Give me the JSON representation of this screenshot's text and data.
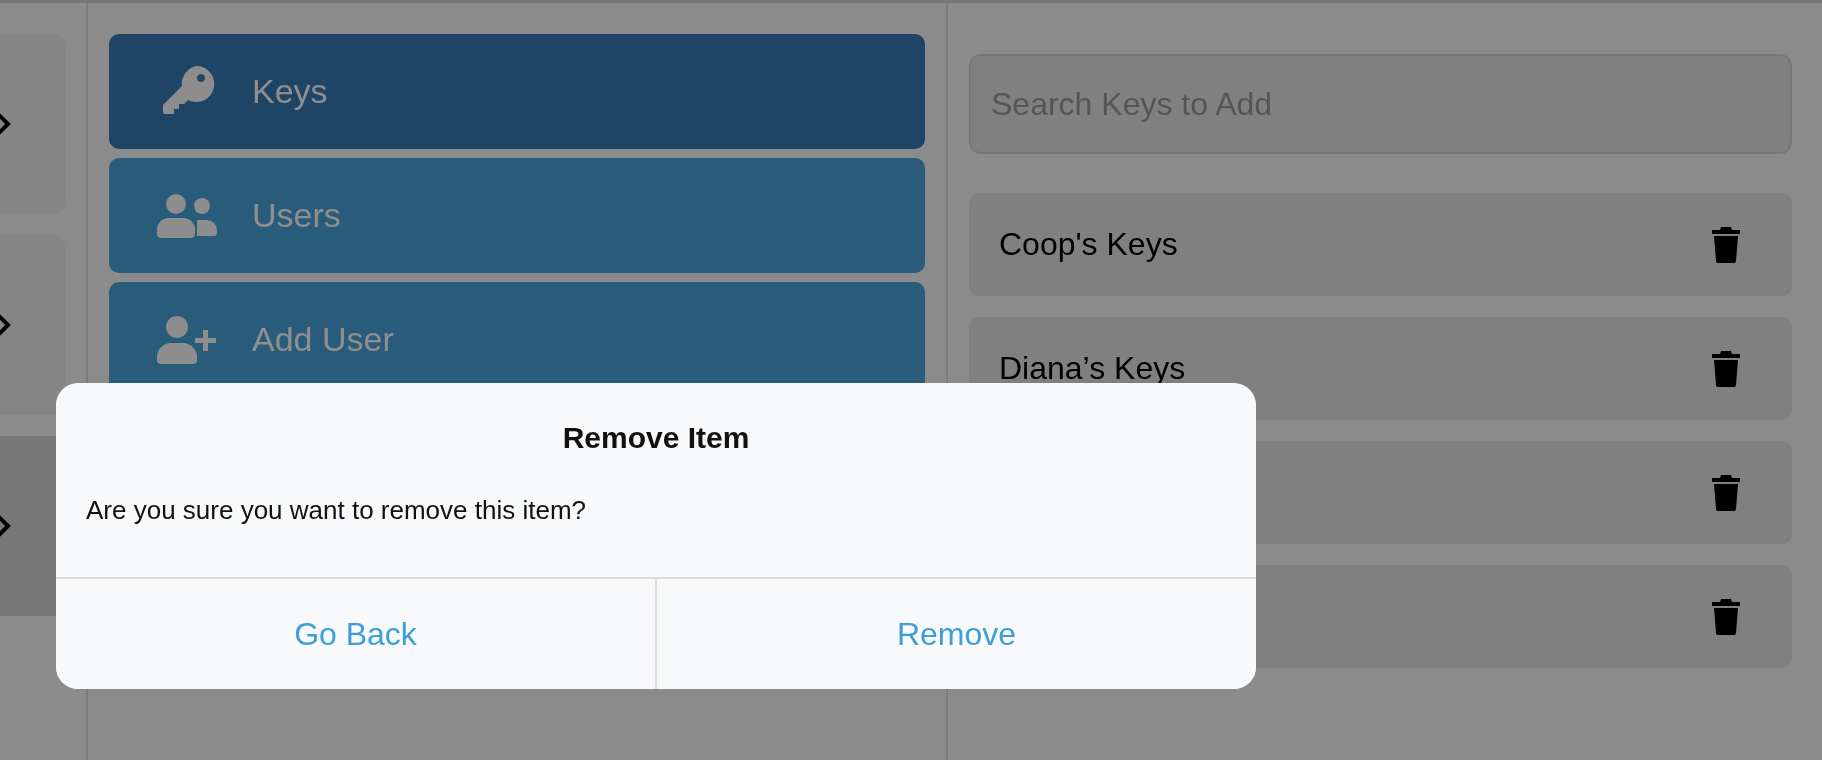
{
  "side_cards": [
    {
      "selected": false
    },
    {
      "selected": false
    },
    {
      "selected": true
    }
  ],
  "menu": [
    {
      "kind": "key",
      "label": "Keys",
      "selected": true
    },
    {
      "kind": "users",
      "label": "Users",
      "selected": false
    },
    {
      "kind": "add-user",
      "label": "Add User",
      "selected": false
    }
  ],
  "search": {
    "placeholder": "Search Keys to Add"
  },
  "key_sets": [
    {
      "kind": "named",
      "name": "Coop's Keys"
    },
    {
      "kind": "named",
      "name": "Diana’s Keys"
    },
    {
      "kind": "covered"
    },
    {
      "kind": "covered"
    }
  ],
  "dialog": {
    "title": "Remove Item",
    "message": "Are you sure you want to remove this item?",
    "buttons": [
      "Go Back",
      "Remove"
    ]
  }
}
